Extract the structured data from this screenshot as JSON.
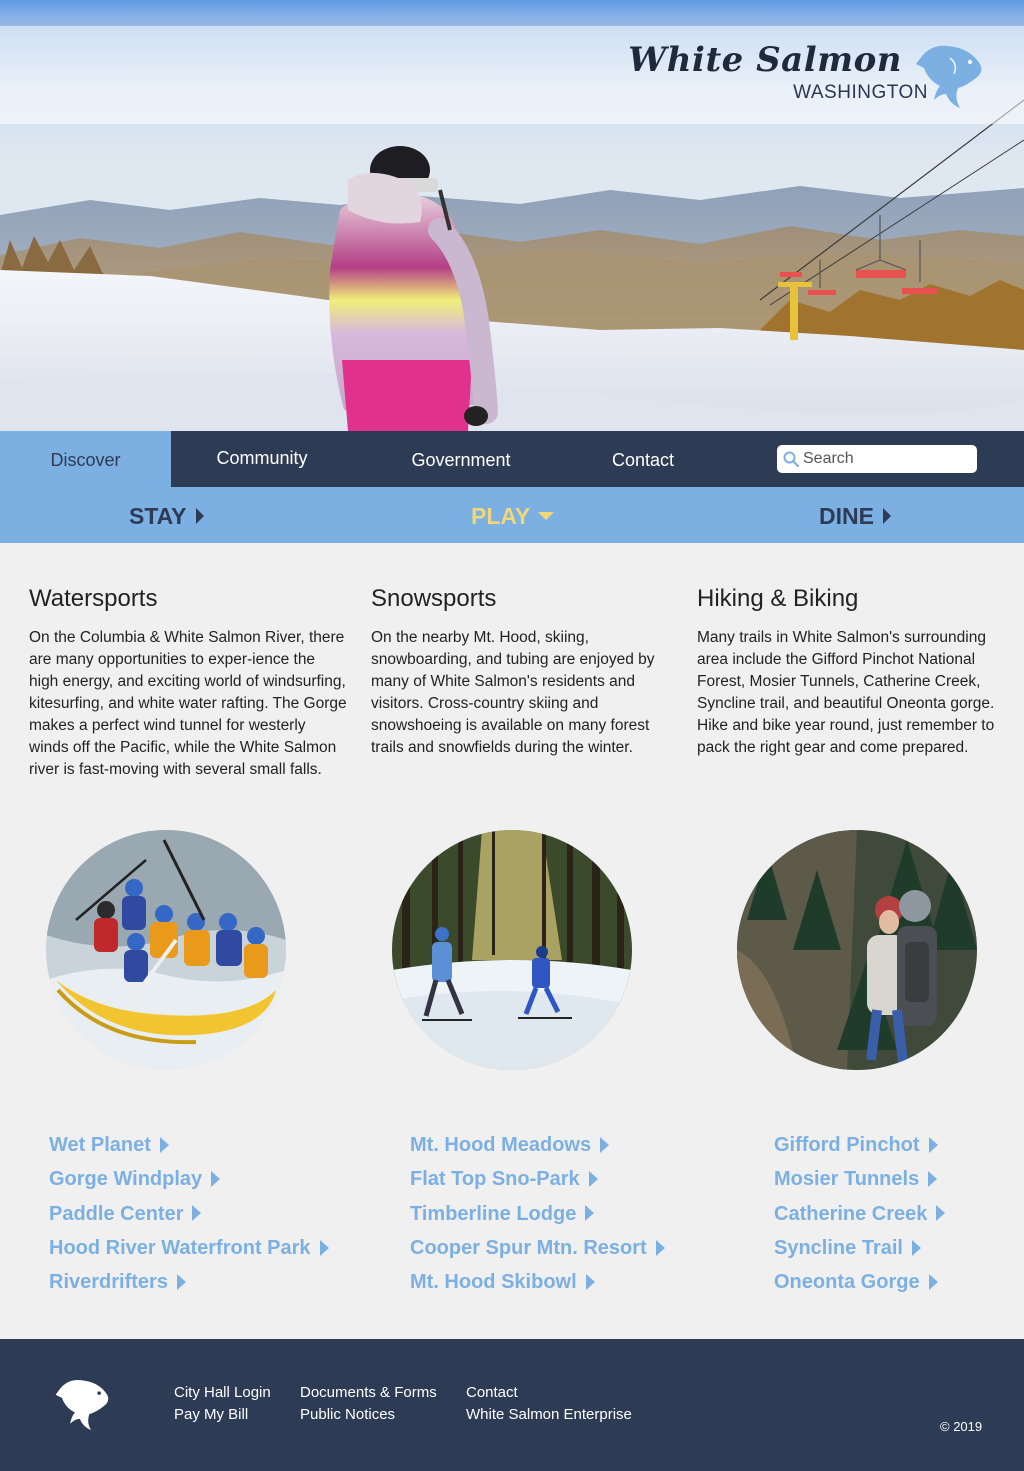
{
  "brand": {
    "title": "White Salmon",
    "subtitle": "WASHINGTON",
    "logo_icon": "salmon-icon"
  },
  "nav": {
    "items": [
      {
        "label": "Discover",
        "active": true
      },
      {
        "label": "Community",
        "active": false
      },
      {
        "label": "Government",
        "active": false
      },
      {
        "label": "Contact",
        "active": false
      }
    ],
    "search": {
      "placeholder": "Search",
      "icon": "search-icon"
    }
  },
  "subnav": {
    "items": [
      {
        "label": "STAY",
        "icon": "caret-right-icon",
        "active": false
      },
      {
        "label": "PLAY",
        "icon": "caret-down-icon",
        "active": true
      },
      {
        "label": "DINE",
        "icon": "caret-right-icon",
        "active": false
      }
    ]
  },
  "sections": [
    {
      "title": "Watersports",
      "body": "On the Columbia & White Salmon River, there are many opportunities to exper-ience the high energy, and exciting world of windsurfing, kitesurfing, and white water rafting. The Gorge makes a perfect wind tunnel for westerly winds off the Pacific, while the White Salmon river is fast-moving with several small falls.",
      "image": "rafting-photo",
      "links": [
        "Wet Planet",
        "Gorge Windplay",
        "Paddle Center",
        "Hood River Waterfront Park",
        "Riverdrifters"
      ]
    },
    {
      "title": "Snowsports",
      "body": "On the nearby Mt. Hood, skiing, snowboarding, and tubing are enjoyed by many of White Salmon's residents and visitors. Cross-country skiing and snowshoeing is available on many forest trails and snowfields during the winter.",
      "image": "cross-country-skiing-photo",
      "links": [
        "Mt. Hood Meadows",
        "Flat Top Sno-Park",
        "Timberline Lodge",
        "Cooper Spur Mtn. Resort",
        "Mt. Hood Skibowl"
      ]
    },
    {
      "title": "Hiking & Biking",
      "body": "Many trails in White Salmon's surrounding area include the Gifford Pinchot National Forest, Mosier Tunnels, Catherine Creek, Syncline trail, and beautiful Oneonta gorge. Hike and bike year round, just remember to pack the right gear and come prepared.",
      "image": "hiking-photo",
      "links": [
        "Gifford Pinchot",
        "Mosier Tunnels",
        "Catherine Creek",
        "Syncline Trail",
        "Oneonta Gorge"
      ]
    }
  ],
  "footer": {
    "links": [
      [
        "City Hall Login",
        "Pay My Bill"
      ],
      [
        "Documents & Forms",
        "Public Notices"
      ],
      [
        "Contact",
        "White Salmon Enterprise"
      ]
    ],
    "copyright": "© 2019"
  },
  "colors": {
    "navy": "#2d3b55",
    "accent_blue": "#7cb0e2",
    "active_yellow": "#f1d779",
    "page_bg": "#f0f0f0"
  }
}
